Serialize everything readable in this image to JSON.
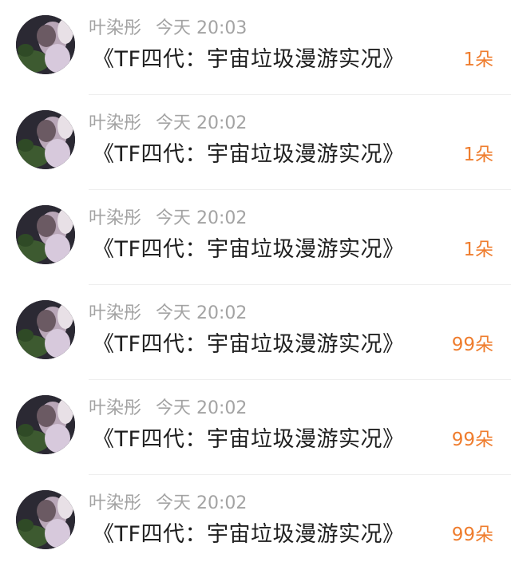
{
  "gifts": [
    {
      "sender": "叶染彤",
      "time": "今天 20:03",
      "message": "《TF四代：宇宙垃圾漫游实况》",
      "amount": "1朵"
    },
    {
      "sender": "叶染彤",
      "time": "今天 20:02",
      "message": "《TF四代：宇宙垃圾漫游实况》",
      "amount": "1朵"
    },
    {
      "sender": "叶染彤",
      "time": "今天 20:02",
      "message": "《TF四代：宇宙垃圾漫游实况》",
      "amount": "1朵"
    },
    {
      "sender": "叶染彤",
      "time": "今天 20:02",
      "message": "《TF四代：宇宙垃圾漫游实况》",
      "amount": "99朵"
    },
    {
      "sender": "叶染彤",
      "time": "今天 20:02",
      "message": "《TF四代：宇宙垃圾漫游实况》",
      "amount": "99朵"
    },
    {
      "sender": "叶染彤",
      "time": "今天 20:02",
      "message": "《TF四代：宇宙垃圾漫游实况》",
      "amount": "99朵"
    }
  ],
  "colors": {
    "amount": "#ef7d2e",
    "meta": "#a3a3a3",
    "message": "#1f1f1f",
    "divider": "#eeeeee"
  }
}
